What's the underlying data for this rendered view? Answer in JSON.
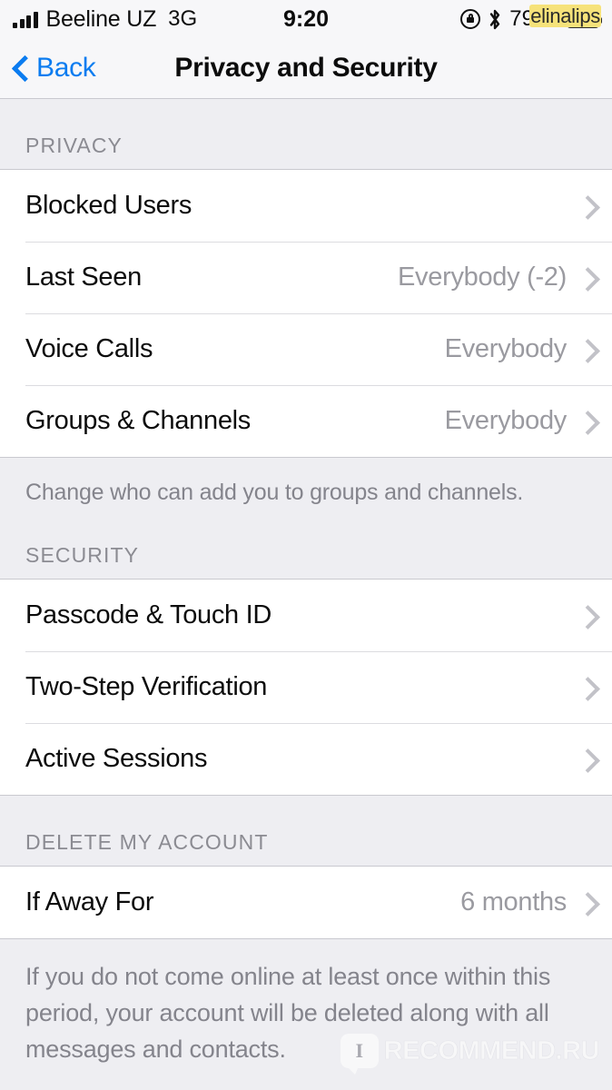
{
  "status_bar": {
    "carrier": "Beeline UZ",
    "network_type": "3G",
    "time": "9:20",
    "battery_percent": "79 %",
    "battery_level": 79,
    "icons": {
      "signal": "signal-bars-icon",
      "rotation_lock": "rotation-lock-icon",
      "bluetooth": "bluetooth-icon",
      "battery": "battery-icon"
    }
  },
  "nav": {
    "back_label": "Back",
    "title": "Privacy and Security"
  },
  "sections": [
    {
      "header": "PRIVACY",
      "rows": [
        {
          "label": "Blocked Users",
          "value": ""
        },
        {
          "label": "Last Seen",
          "value": "Everybody (-2)"
        },
        {
          "label": "Voice Calls",
          "value": "Everybody"
        },
        {
          "label": "Groups & Channels",
          "value": "Everybody"
        }
      ],
      "footnote": "Change who can add you to groups and channels."
    },
    {
      "header": "SECURITY",
      "rows": [
        {
          "label": "Passcode & Touch ID",
          "value": ""
        },
        {
          "label": "Two-Step Verification",
          "value": ""
        },
        {
          "label": "Active Sessions",
          "value": ""
        }
      ],
      "footnote": ""
    },
    {
      "header": "DELETE MY ACCOUNT",
      "rows": [
        {
          "label": "If Away For",
          "value": "6 months"
        }
      ],
      "footnote": "If you do not come online at least once within this period, your account will be deleted along with all messages and contacts."
    }
  ],
  "watermarks": {
    "top": "elinalips",
    "bottom_badge": "I",
    "bottom_text": "RECOMMEND.RU"
  },
  "colors": {
    "accent_blue": "#0b7cf0",
    "page_background": "#eeeef2",
    "row_background": "#ffffff",
    "secondary_text": "#9a9aa0",
    "header_text": "#8b8b92"
  }
}
